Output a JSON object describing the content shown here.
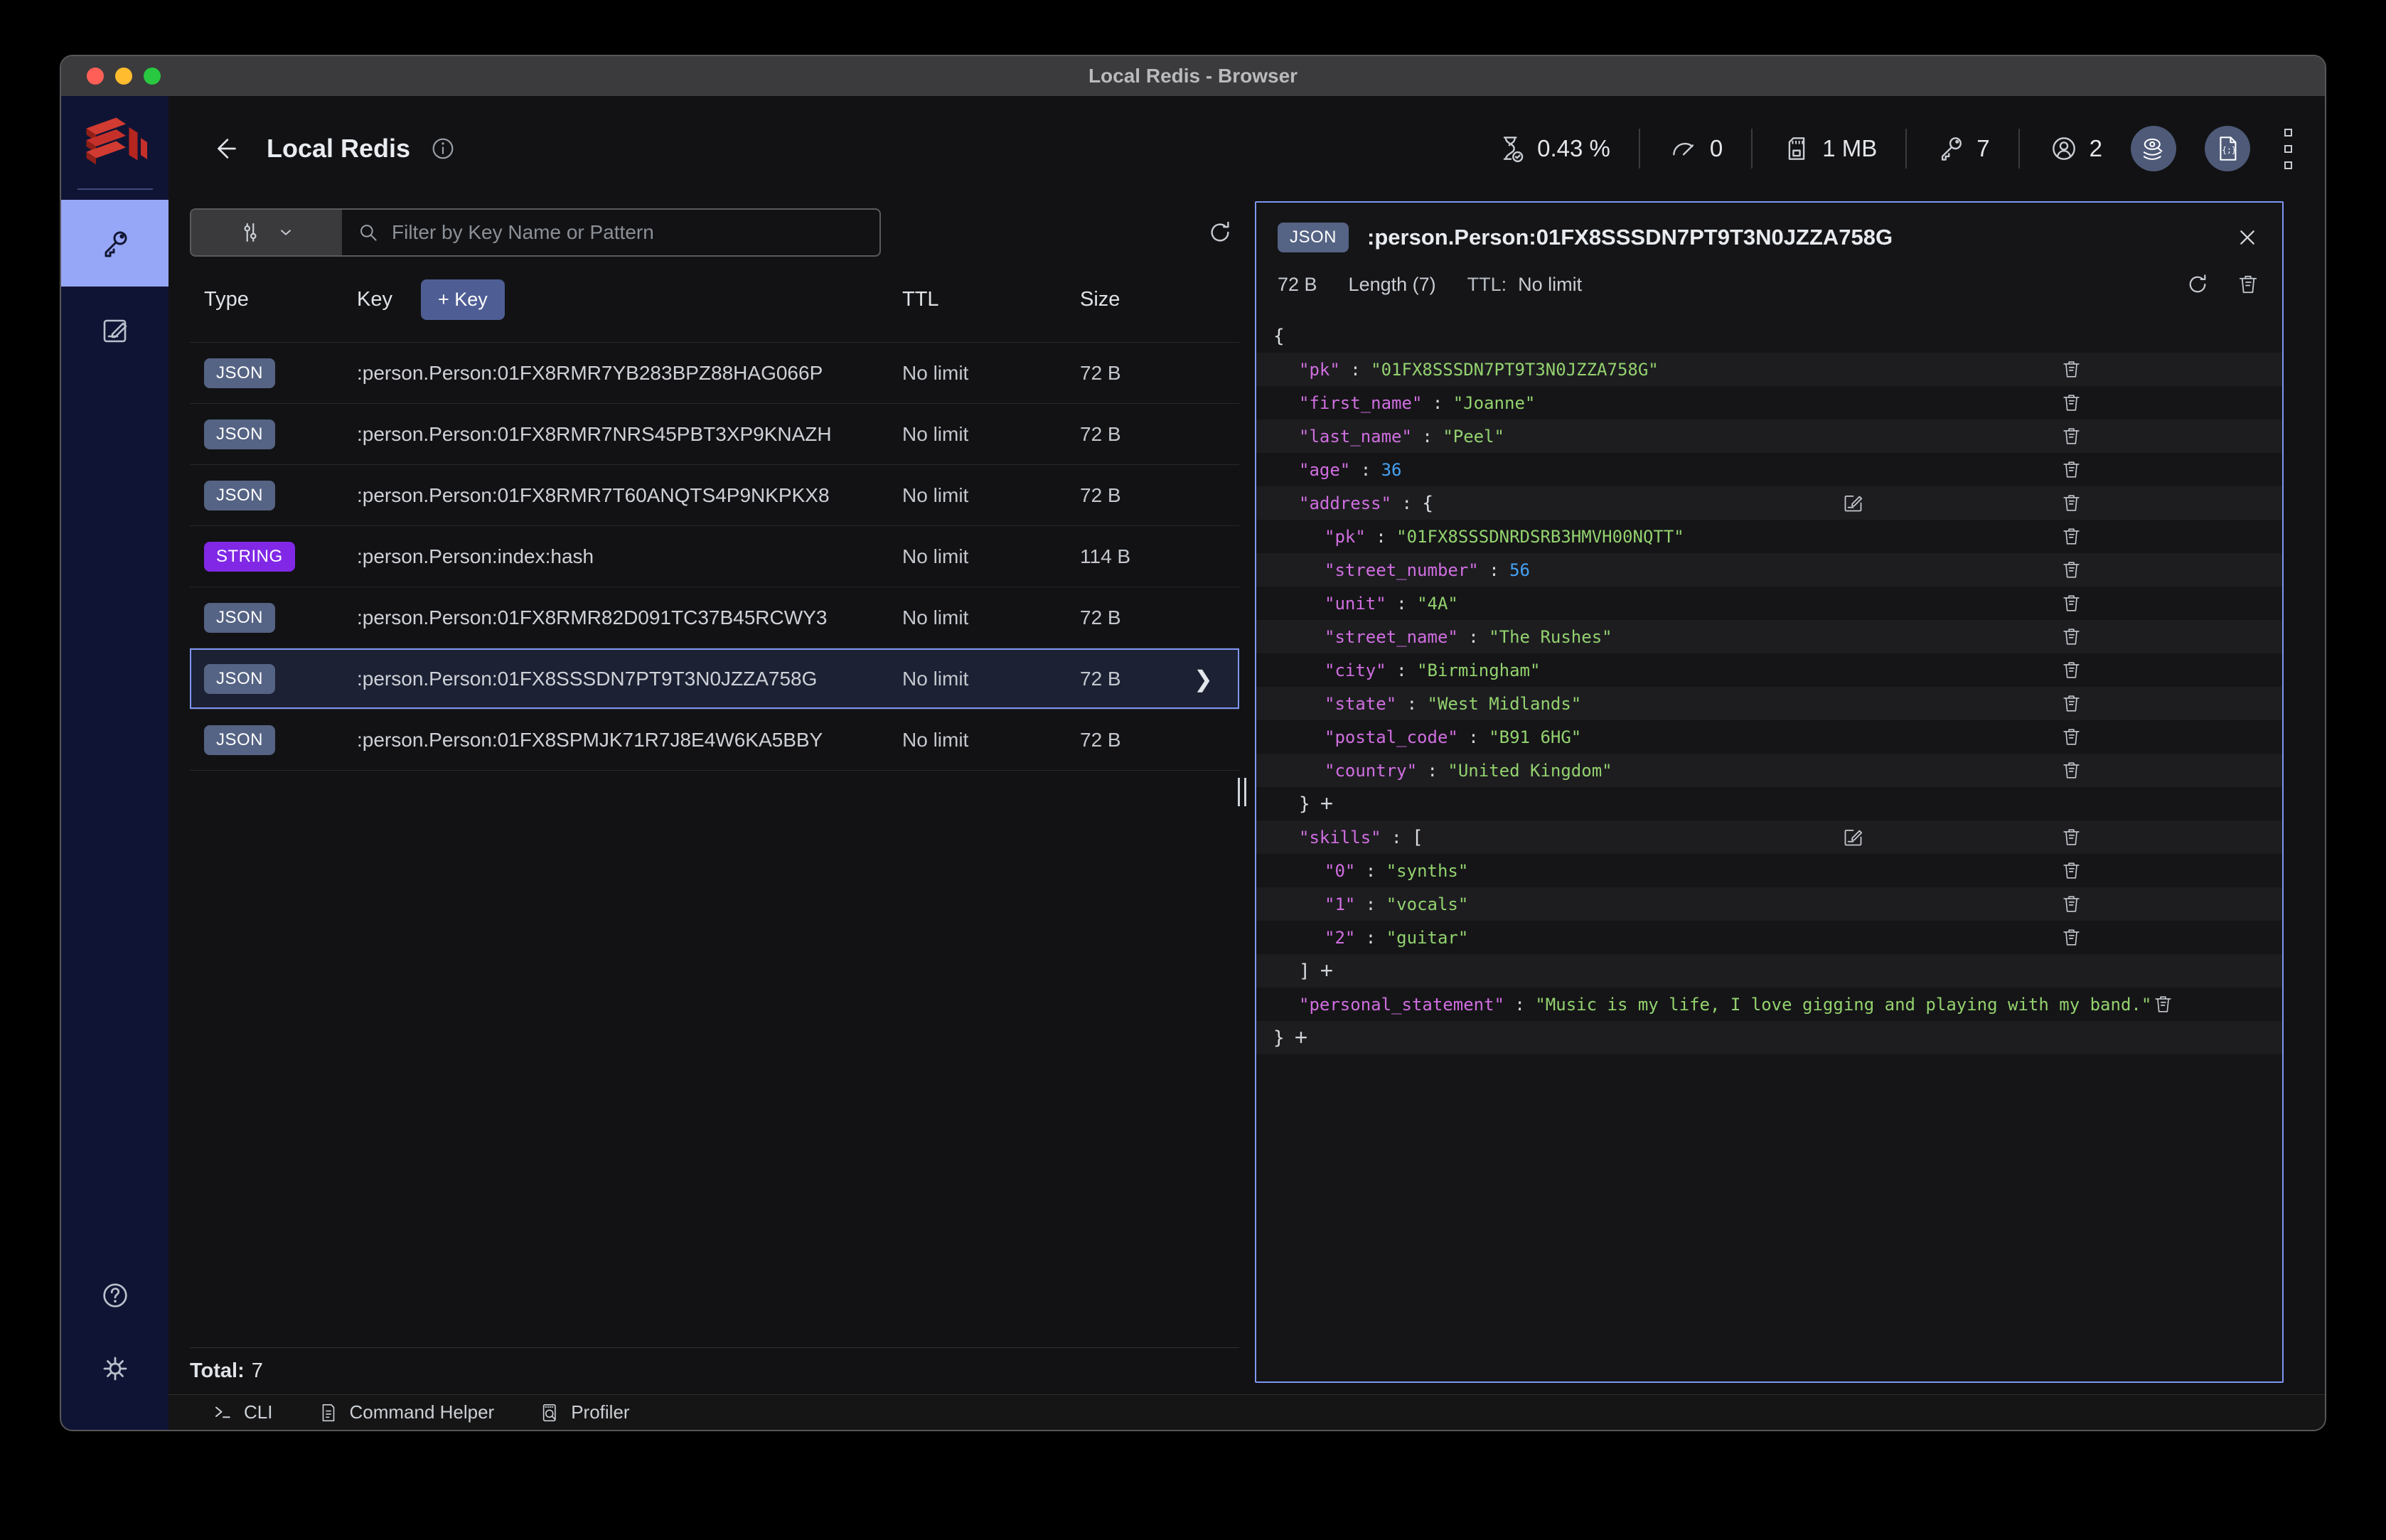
{
  "titlebar": {
    "title": "Local Redis - Browser"
  },
  "header": {
    "title": "Local Redis",
    "stats": {
      "cpu": "0.43 %",
      "ops": "0",
      "memory": "1 MB",
      "keys": "7",
      "clients": "2"
    }
  },
  "keys_panel": {
    "filter_placeholder": "Filter by Key Name or Pattern",
    "columns": {
      "type": "Type",
      "key": "Key",
      "add_key": "+ Key",
      "ttl": "TTL",
      "size": "Size"
    },
    "rows": [
      {
        "type": "JSON",
        "tclass": "json",
        "key": ":person.Person:01FX8RMR7YB283BPZ88HAG066P",
        "ttl": "No limit",
        "size": "72 B"
      },
      {
        "type": "JSON",
        "tclass": "json",
        "key": ":person.Person:01FX8RMR7NRS45PBT3XP9KNAZH",
        "ttl": "No limit",
        "size": "72 B"
      },
      {
        "type": "JSON",
        "tclass": "json",
        "key": ":person.Person:01FX8RMR7T60ANQTS4P9NKPKX8",
        "ttl": "No limit",
        "size": "72 B"
      },
      {
        "type": "STRING",
        "tclass": "string",
        "key": ":person.Person:index:hash",
        "ttl": "No limit",
        "size": "114 B"
      },
      {
        "type": "JSON",
        "tclass": "json",
        "key": ":person.Person:01FX8RMR82D091TC37B45RCWY3",
        "ttl": "No limit",
        "size": "72 B"
      },
      {
        "type": "JSON",
        "tclass": "json",
        "key": ":person.Person:01FX8SSSDN7PT9T3N0JZZA758G",
        "ttl": "No limit",
        "size": "72 B",
        "sel": true,
        "state": "selected"
      },
      {
        "type": "JSON",
        "tclass": "json",
        "key": ":person.Person:01FX8SPMJK71R7J8E4W6KA5BBY",
        "ttl": "No limit",
        "size": "72 B"
      }
    ],
    "total_label": "Total:",
    "total_value": "7"
  },
  "detail": {
    "type_badge": "JSON",
    "key": ":person.Person:01FX8SSSDN7PT9T3N0JZZA758G",
    "size": "72 B",
    "length_label": "Length (7)",
    "ttl_label": "TTL:",
    "ttl_value": "No limit",
    "colon": " : ",
    "plus_sign": "+",
    "json_rows": [
      {
        "indent": 0,
        "punct": "{"
      },
      {
        "indent": 1,
        "key": "\"pk\"",
        "value": "\"01FX8SSSDN7PT9T3N0JZZA758G\"",
        "vclass": "str",
        "del": true
      },
      {
        "indent": 1,
        "key": "\"first_name\"",
        "value": "\"Joanne\"",
        "vclass": "str",
        "del": true
      },
      {
        "indent": 1,
        "key": "\"last_name\"",
        "value": "\"Peel\"",
        "vclass": "str",
        "del": true
      },
      {
        "indent": 1,
        "key": "\"age\"",
        "value": "36",
        "vclass": "num",
        "del": true
      },
      {
        "indent": 1,
        "key": "\"address\"",
        "open": "{",
        "edit": true,
        "del": true
      },
      {
        "indent": 2,
        "key": "\"pk\"",
        "value": "\"01FX8SSSDNRDSRB3HMVH00NQTT\"",
        "vclass": "str",
        "del": true
      },
      {
        "indent": 2,
        "key": "\"street_number\"",
        "value": "56",
        "vclass": "num",
        "del": true
      },
      {
        "indent": 2,
        "key": "\"unit\"",
        "value": "\"4A\"",
        "vclass": "str",
        "del": true
      },
      {
        "indent": 2,
        "key": "\"street_name\"",
        "value": "\"The Rushes\"",
        "vclass": "str",
        "del": true
      },
      {
        "indent": 2,
        "key": "\"city\"",
        "value": "\"Birmingham\"",
        "vclass": "str",
        "del": true
      },
      {
        "indent": 2,
        "key": "\"state\"",
        "value": "\"West Midlands\"",
        "vclass": "str",
        "del": true
      },
      {
        "indent": 2,
        "key": "\"postal_code\"",
        "value": "\"B91 6HG\"",
        "vclass": "str",
        "del": true
      },
      {
        "indent": 2,
        "key": "\"country\"",
        "value": "\"United Kingdom\"",
        "vclass": "str",
        "del": true
      },
      {
        "indent": 1,
        "punct": "}",
        "plus": true
      },
      {
        "indent": 1,
        "key": "\"skills\"",
        "open": "[",
        "edit": true,
        "del": true
      },
      {
        "indent": 2,
        "key": "\"0\"",
        "value": "\"synths\"",
        "vclass": "str",
        "del": true
      },
      {
        "indent": 2,
        "key": "\"1\"",
        "value": "\"vocals\"",
        "vclass": "str",
        "del": true
      },
      {
        "indent": 2,
        "key": "\"2\"",
        "value": "\"guitar\"",
        "vclass": "str",
        "del": true
      },
      {
        "indent": 1,
        "punct": "]",
        "plus": true
      },
      {
        "indent": 1,
        "key": "\"personal_statement\"",
        "value": "\"Music is my life, I love gigging and playing with my band.\"",
        "vclass": "str",
        "del": true
      },
      {
        "indent": 0,
        "punct": "}",
        "plus": true
      }
    ]
  },
  "bottom_bar": {
    "cli": "CLI",
    "command_helper": "Command Helper",
    "profiler": "Profiler"
  },
  "colors": {
    "accent": "#7e97f2",
    "sidebar_active": "#97a7f7",
    "badge_json": "#556384",
    "badge_string": "#8128e6",
    "json_key": "#d06ee0",
    "json_string": "#93d26e",
    "json_number": "#45a2f5",
    "traffic_red": "#ff5f57",
    "traffic_yellow": "#febc2e",
    "traffic_green": "#28c840"
  }
}
